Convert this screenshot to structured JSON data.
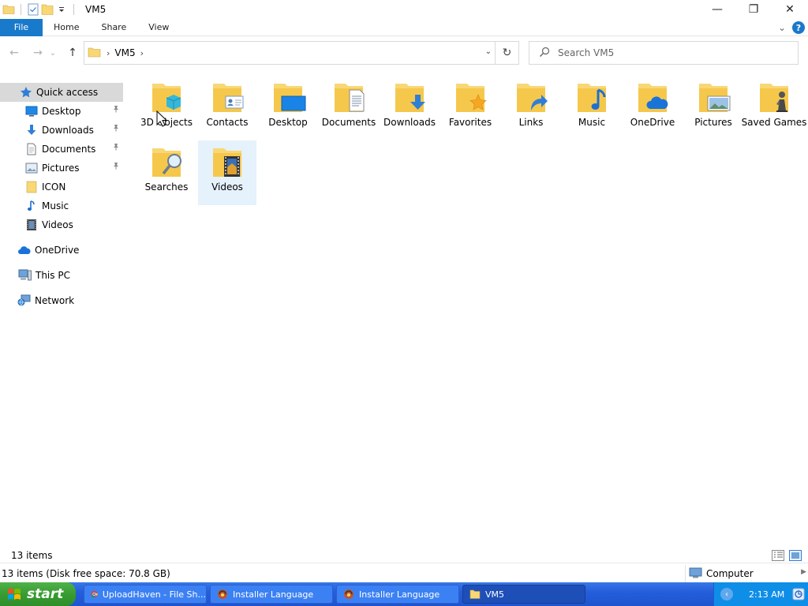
{
  "window": {
    "title": "VM5",
    "minimize_glyph": "—",
    "restore_glyph": "❐",
    "close_glyph": "✕"
  },
  "ribbon": {
    "tabs": [
      "File",
      "Home",
      "Share",
      "View"
    ],
    "expand_glyph": "⌄",
    "help_glyph": "?"
  },
  "address": {
    "path": "VM5",
    "back_glyph": "←",
    "forward_glyph": "→",
    "recent_glyph": "⌄",
    "up_glyph": "↑",
    "sep_glyph": "›",
    "dropdown_glyph": "⌄",
    "refresh_glyph": "↻"
  },
  "search": {
    "placeholder": "Search VM5"
  },
  "nav": {
    "items": [
      {
        "label": "Quick access",
        "icon": "star-icon"
      },
      {
        "label": "Desktop",
        "icon": "desktop-icon",
        "pinned": true
      },
      {
        "label": "Downloads",
        "icon": "download-icon",
        "pinned": true
      },
      {
        "label": "Documents",
        "icon": "document-icon",
        "pinned": true
      },
      {
        "label": "Pictures",
        "icon": "picture-icon",
        "pinned": true
      },
      {
        "label": "ICON",
        "icon": "folder-icon"
      },
      {
        "label": "Music",
        "icon": "music-icon"
      },
      {
        "label": "Videos",
        "icon": "video-icon"
      },
      {
        "label": "OneDrive",
        "icon": "cloud-icon"
      },
      {
        "label": "This PC",
        "icon": "computer-icon"
      },
      {
        "label": "Network",
        "icon": "network-icon"
      }
    ],
    "pin_glyph": "📌"
  },
  "folders": [
    {
      "label": "3D Objects",
      "icon": "3d-objects-icon"
    },
    {
      "label": "Contacts",
      "icon": "contacts-icon"
    },
    {
      "label": "Desktop",
      "icon": "desktop-icon"
    },
    {
      "label": "Documents",
      "icon": "documents-icon"
    },
    {
      "label": "Downloads",
      "icon": "downloads-icon"
    },
    {
      "label": "Favorites",
      "icon": "favorites-icon"
    },
    {
      "label": "Links",
      "icon": "links-icon"
    },
    {
      "label": "Music",
      "icon": "music-icon"
    },
    {
      "label": "OneDrive",
      "icon": "onedrive-icon"
    },
    {
      "label": "Pictures",
      "icon": "pictures-icon"
    },
    {
      "label": "Saved Games",
      "icon": "saved-games-icon"
    },
    {
      "label": "Searches",
      "icon": "searches-icon"
    },
    {
      "label": "Videos",
      "icon": "videos-icon",
      "selected": true
    }
  ],
  "status": {
    "item_count": "13 items",
    "details": "13 items (Disk free space: 70.8 GB)",
    "location": "Computer"
  },
  "taskbar": {
    "start": "start",
    "tasks": [
      {
        "label": "UploadHaven - File Sh...",
        "icon": "chrome-icon"
      },
      {
        "label": "Installer Language",
        "icon": "installer-icon"
      },
      {
        "label": "Installer Language",
        "icon": "installer-icon"
      },
      {
        "label": "VM5",
        "icon": "folder-icon",
        "active": true
      }
    ],
    "tray_chevron": "‹",
    "clock": "2:13 AM"
  },
  "colors": {
    "accent": "#1979ca",
    "folder": "#f8d775",
    "taskbar": "#245edb",
    "start": "#379c31",
    "selection": "#e5f1fb"
  }
}
